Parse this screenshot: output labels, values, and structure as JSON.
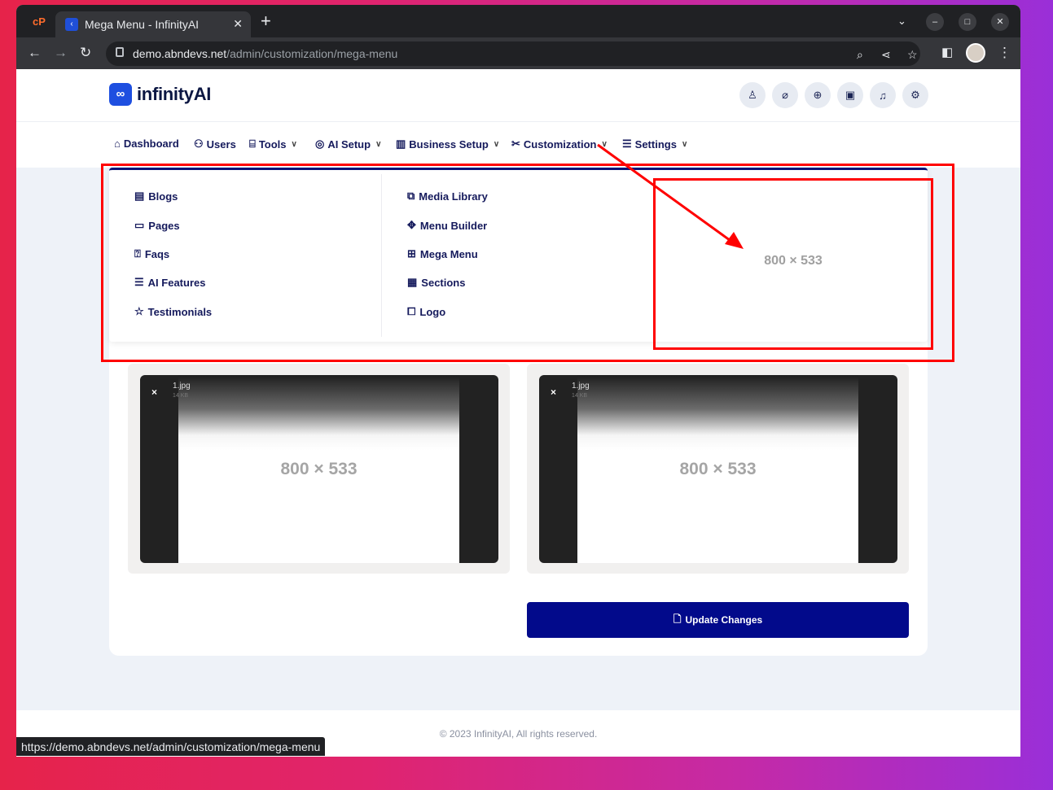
{
  "browser": {
    "tab_title": "Mega Menu - InfinityAI",
    "url_host": "demo.abndevs.net",
    "url_path": "/admin/customization/mega-menu",
    "status_url": "https://demo.abndevs.net/admin/customization/mega-menu"
  },
  "brand": {
    "name": "infinityAI",
    "mark": "∞"
  },
  "nav": [
    {
      "label": "Dashboard"
    },
    {
      "label": "Users"
    },
    {
      "label": "Tools"
    },
    {
      "label": "AI Setup"
    },
    {
      "label": "Business Setup"
    },
    {
      "label": "Customization"
    },
    {
      "label": "Settings"
    }
  ],
  "mega_menu": {
    "left": [
      "Blogs",
      "Pages",
      "Faqs",
      "AI Features",
      "Testimonials"
    ],
    "right": [
      "Media Library",
      "Menu Builder",
      "Mega Menu",
      "Sections",
      "Logo"
    ],
    "placeholder": "800 × 533"
  },
  "uploads": [
    {
      "filename": "1.jpg",
      "size": "14 KB",
      "placeholder": "800 × 533",
      "remove": "×"
    },
    {
      "filename": "1.jpg",
      "size": "14 KB",
      "placeholder": "800 × 533",
      "remove": "×"
    }
  ],
  "update_button": "Update Changes",
  "footer": "© 2023 InfinityAI, All rights reserved.",
  "colors": {
    "primary": "#020a8b",
    "annotation": "#ff0000",
    "text": "#151a5c"
  }
}
